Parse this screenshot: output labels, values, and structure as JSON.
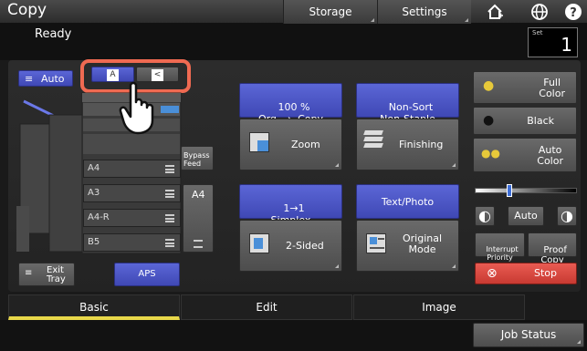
{
  "header": {
    "title": "Copy",
    "storage": "Storage",
    "settings": "Settings"
  },
  "status": {
    "text": "Ready",
    "set_label": "Set",
    "set_value": "1"
  },
  "machine": {
    "auto_label": "Auto",
    "orient_a": "A",
    "orient_b": "<",
    "trays": [
      "A4",
      "A3",
      "A4-R",
      "B5"
    ],
    "bypass_label": "Bypass\nFeed",
    "bypass_size": "A4",
    "exit_label": "Exit\nTray",
    "aps_label": "APS"
  },
  "functions": {
    "zoom_status": "100 %\nOrg  →  Copy",
    "zoom_label": "Zoom",
    "finishing_status": "Non-Sort\nNon-Staple",
    "finishing_label": "Finishing",
    "duplex_status": "1→1\nSimplex",
    "duplex_label": "2-Sided",
    "mode_status": "Text/Photo",
    "mode_label": "Original\nMode"
  },
  "color": {
    "full": "Full\nColor",
    "black": "Black",
    "auto": "Auto\nColor"
  },
  "density": {
    "auto_label": "Auto",
    "level": 0.33
  },
  "actions": {
    "interrupt": "Interrupt\nPriority",
    "proof": "Proof\nCopy",
    "stop": "Stop"
  },
  "tabs": [
    "Basic",
    "Edit",
    "Image"
  ],
  "job_status": "Job Status"
}
